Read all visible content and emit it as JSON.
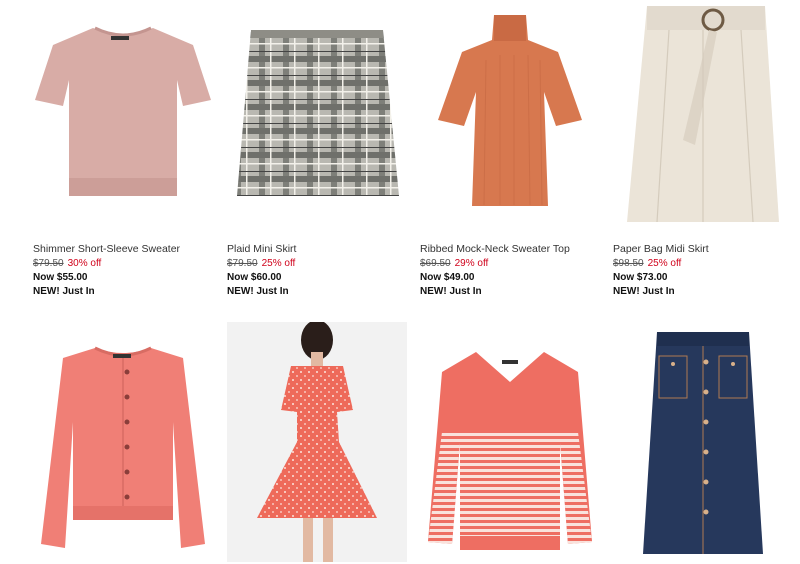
{
  "products": [
    {
      "name": "Shimmer Short-Sleeve Sweater",
      "original_price": "$79.50",
      "discount": "30% off",
      "now_price": "Now $55.00",
      "badge": "NEW! Just In",
      "image": "pink-short-sleeve-sweater",
      "color": "#d8aca6"
    },
    {
      "name": "Plaid Mini Skirt",
      "original_price": "$79.50",
      "discount": "25% off",
      "now_price": "Now $60.00",
      "badge": "NEW! Just In",
      "image": "plaid-mini-skirt",
      "color": "#9a9a94"
    },
    {
      "name": "Ribbed Mock-Neck Sweater Top",
      "original_price": "$69.50",
      "discount": "29% off",
      "now_price": "Now $49.00",
      "badge": "NEW! Just In",
      "image": "orange-mock-neck-top",
      "color": "#d7784f"
    },
    {
      "name": "Paper Bag Midi Skirt",
      "original_price": "$98.50",
      "discount": "25% off",
      "now_price": "Now $73.00",
      "badge": "NEW! Just In",
      "image": "cream-paper-bag-skirt",
      "color": "#ebe4d8"
    },
    {
      "image": "coral-cardigan",
      "color": "#f07f76"
    },
    {
      "image": "coral-print-wrap-dress",
      "color": "#ee6a5a"
    },
    {
      "image": "coral-striped-v-neck-sweater",
      "color": "#ee6e62"
    },
    {
      "image": "denim-button-front-skirt",
      "color": "#26385c"
    }
  ]
}
